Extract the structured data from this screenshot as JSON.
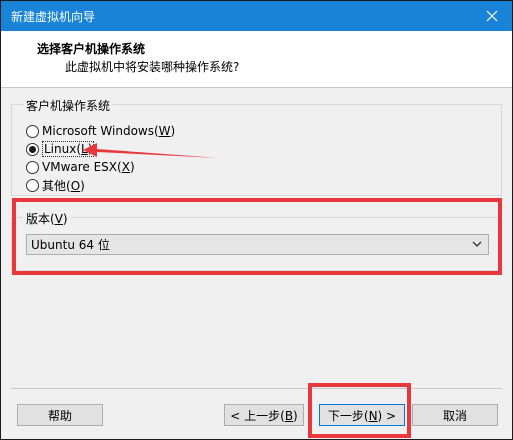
{
  "window": {
    "title": "新建虚拟机向导"
  },
  "header": {
    "title": "选择客户机操作系统",
    "subtitle": "此虚拟机中将安装哪种操作系统?"
  },
  "os_group": {
    "label": "客户机操作系统",
    "options": [
      {
        "label": "Microsoft Windows(",
        "key": "W",
        "suffix": ")",
        "selected": false
      },
      {
        "label": "Linux(",
        "key": "L",
        "suffix": ")",
        "selected": true
      },
      {
        "label": "VMware ESX(",
        "key": "X",
        "suffix": ")",
        "selected": false
      },
      {
        "label": "其他(",
        "key": "O",
        "suffix": ")",
        "selected": false
      }
    ]
  },
  "version_group": {
    "label": "版本(",
    "key": "V",
    "suffix": ")",
    "selected_value": "Ubuntu 64 位"
  },
  "buttons": {
    "help": "帮助",
    "back": "< 上一步(",
    "back_key": "B",
    "back_suffix": ")",
    "next": "下一步(",
    "next_key": "N",
    "next_suffix": ") >",
    "cancel": "取消"
  },
  "colors": {
    "titlebar": "#1883d7",
    "annotation_red": "#e8383d",
    "focus_blue": "#0078d7"
  }
}
